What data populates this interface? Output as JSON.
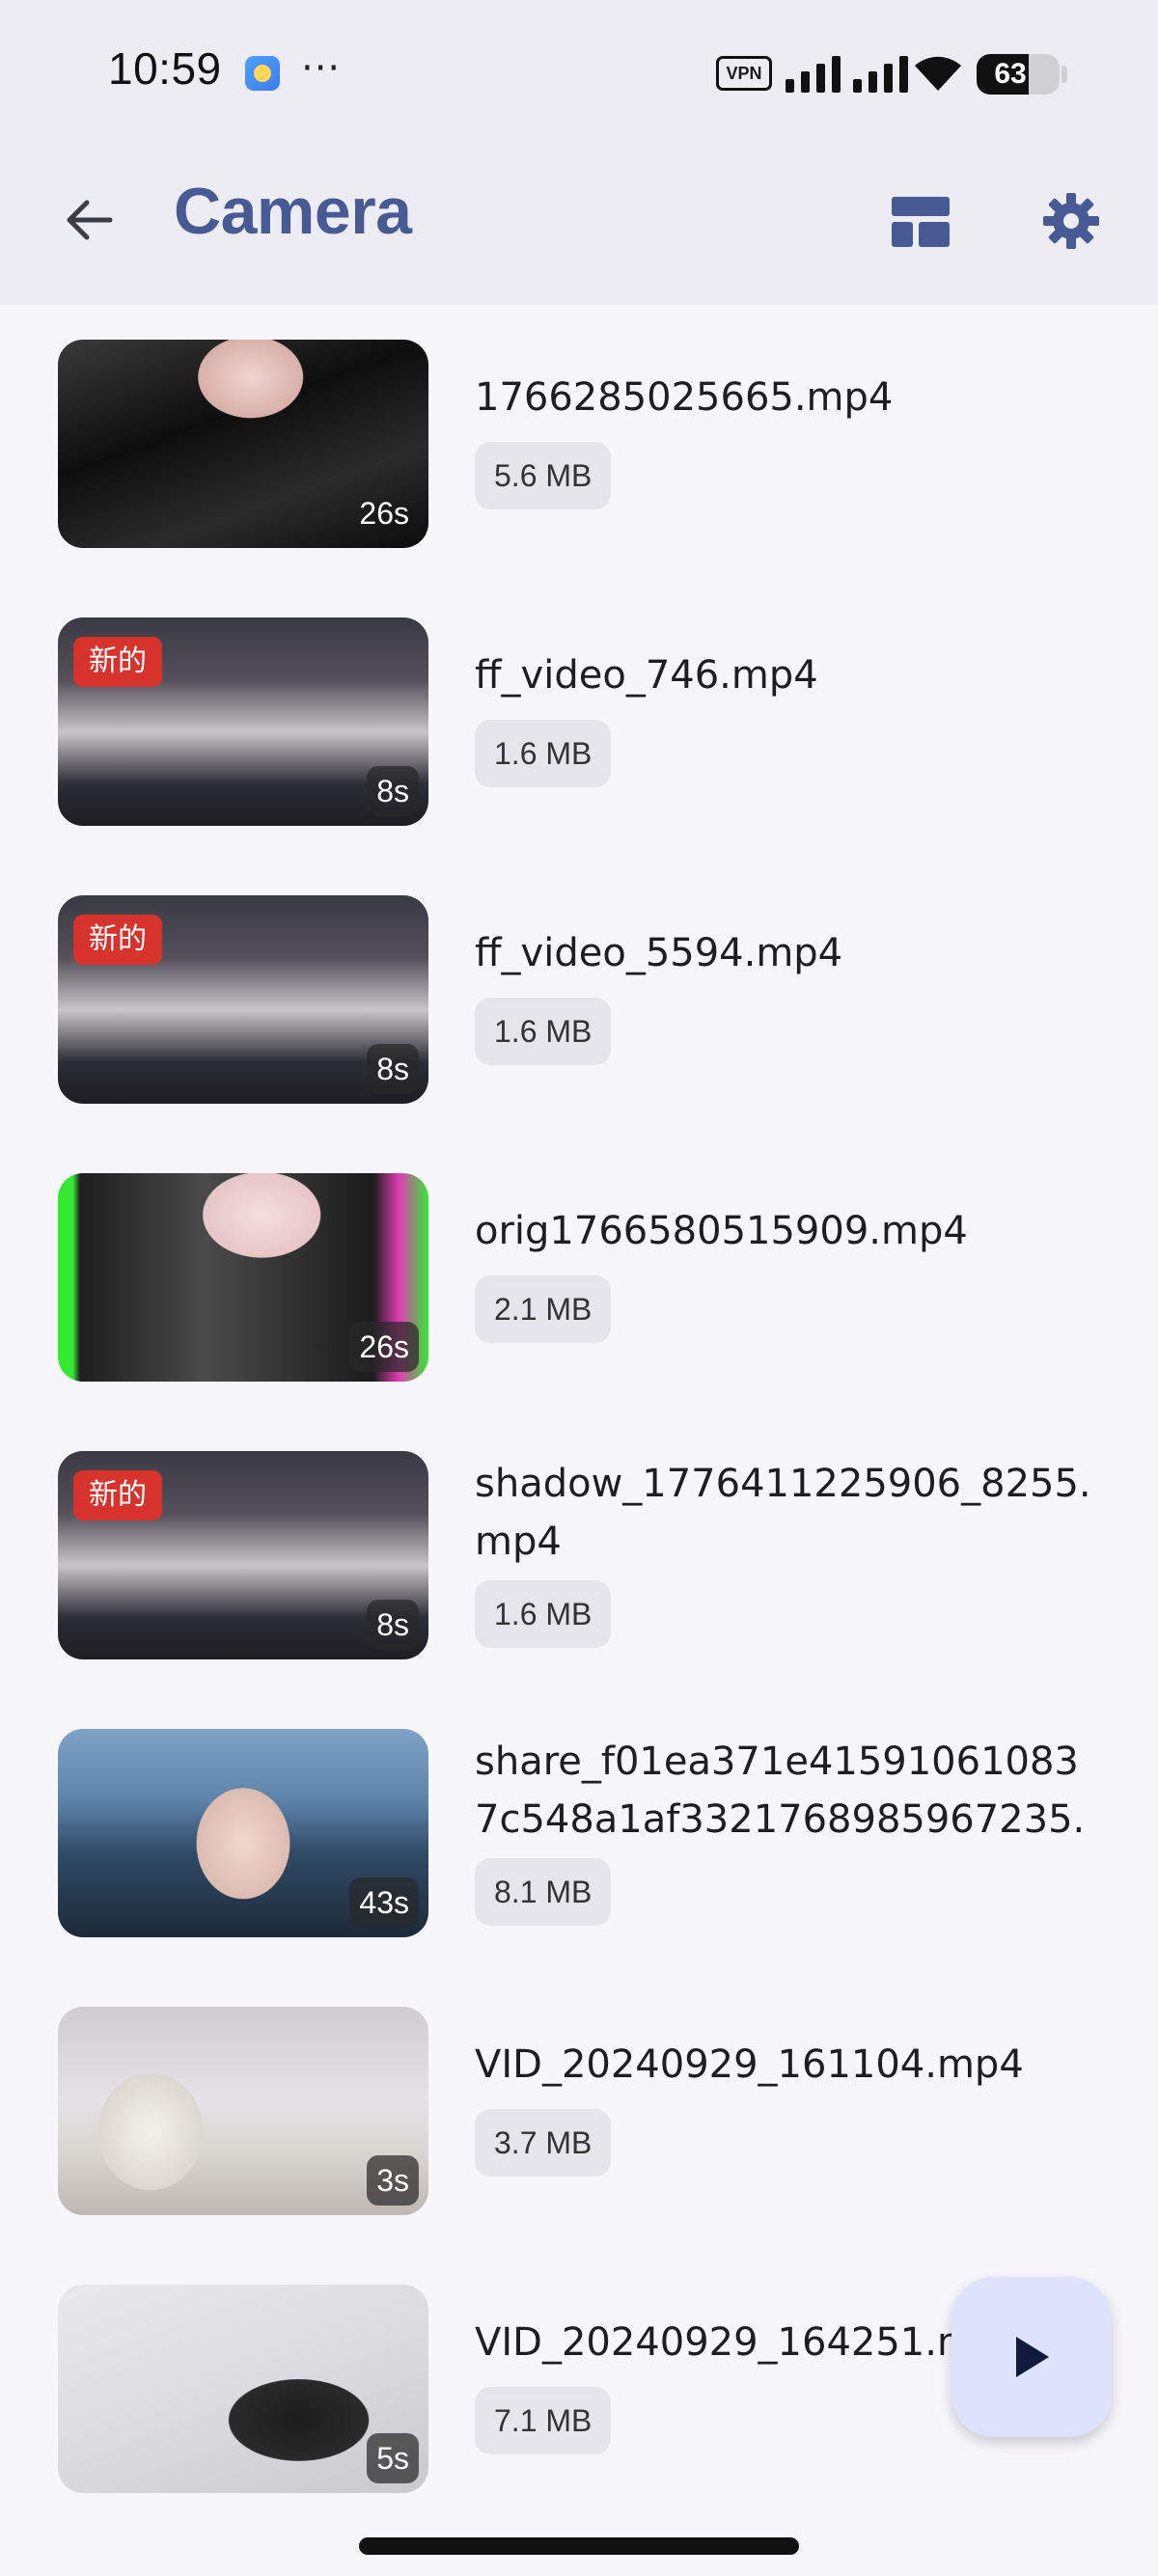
{
  "status_bar": {
    "time": "10:59",
    "more_dots": "···",
    "vpn_label": "VPN",
    "battery_level": "63",
    "battery_fraction": 0.63
  },
  "app_bar": {
    "title": "Camera",
    "icons": [
      "arrow-back-icon",
      "grid-layout-icon",
      "gear-icon"
    ],
    "title_color": "#475a93"
  },
  "videos": [
    {
      "name": "1766285025665.mp4",
      "size": "5.6 MB",
      "duration": "26s",
      "new_label": ""
    },
    {
      "name": "ff_video_746.mp4",
      "size": "1.6 MB",
      "duration": "8s",
      "new_label": "新的"
    },
    {
      "name": "ff_video_5594.mp4",
      "size": "1.6 MB",
      "duration": "8s",
      "new_label": "新的"
    },
    {
      "name": "orig1766580515909.mp4",
      "size": "2.1 MB",
      "duration": "26s",
      "new_label": ""
    },
    {
      "name": "shadow_1776411225906_8255.mp4",
      "size": "1.6 MB",
      "duration": "8s",
      "new_label": "新的"
    },
    {
      "name": "share_f01ea371e415910610837c548a1af3321768985967235.m…",
      "size": "8.1 MB",
      "duration": "43s",
      "new_label": ""
    },
    {
      "name": "VID_20240929_161104.mp4",
      "size": "3.7 MB",
      "duration": "3s",
      "new_label": ""
    },
    {
      "name": "VID_20240929_164251.mp4",
      "size": "7.1 MB",
      "duration": "5s",
      "new_label": ""
    }
  ],
  "fab": {
    "icon": "play-icon"
  },
  "colors": {
    "background": "#f7f6fb",
    "appbar": "#ececf2",
    "new_badge": "#d6332c",
    "fab": "#dde3fb"
  }
}
